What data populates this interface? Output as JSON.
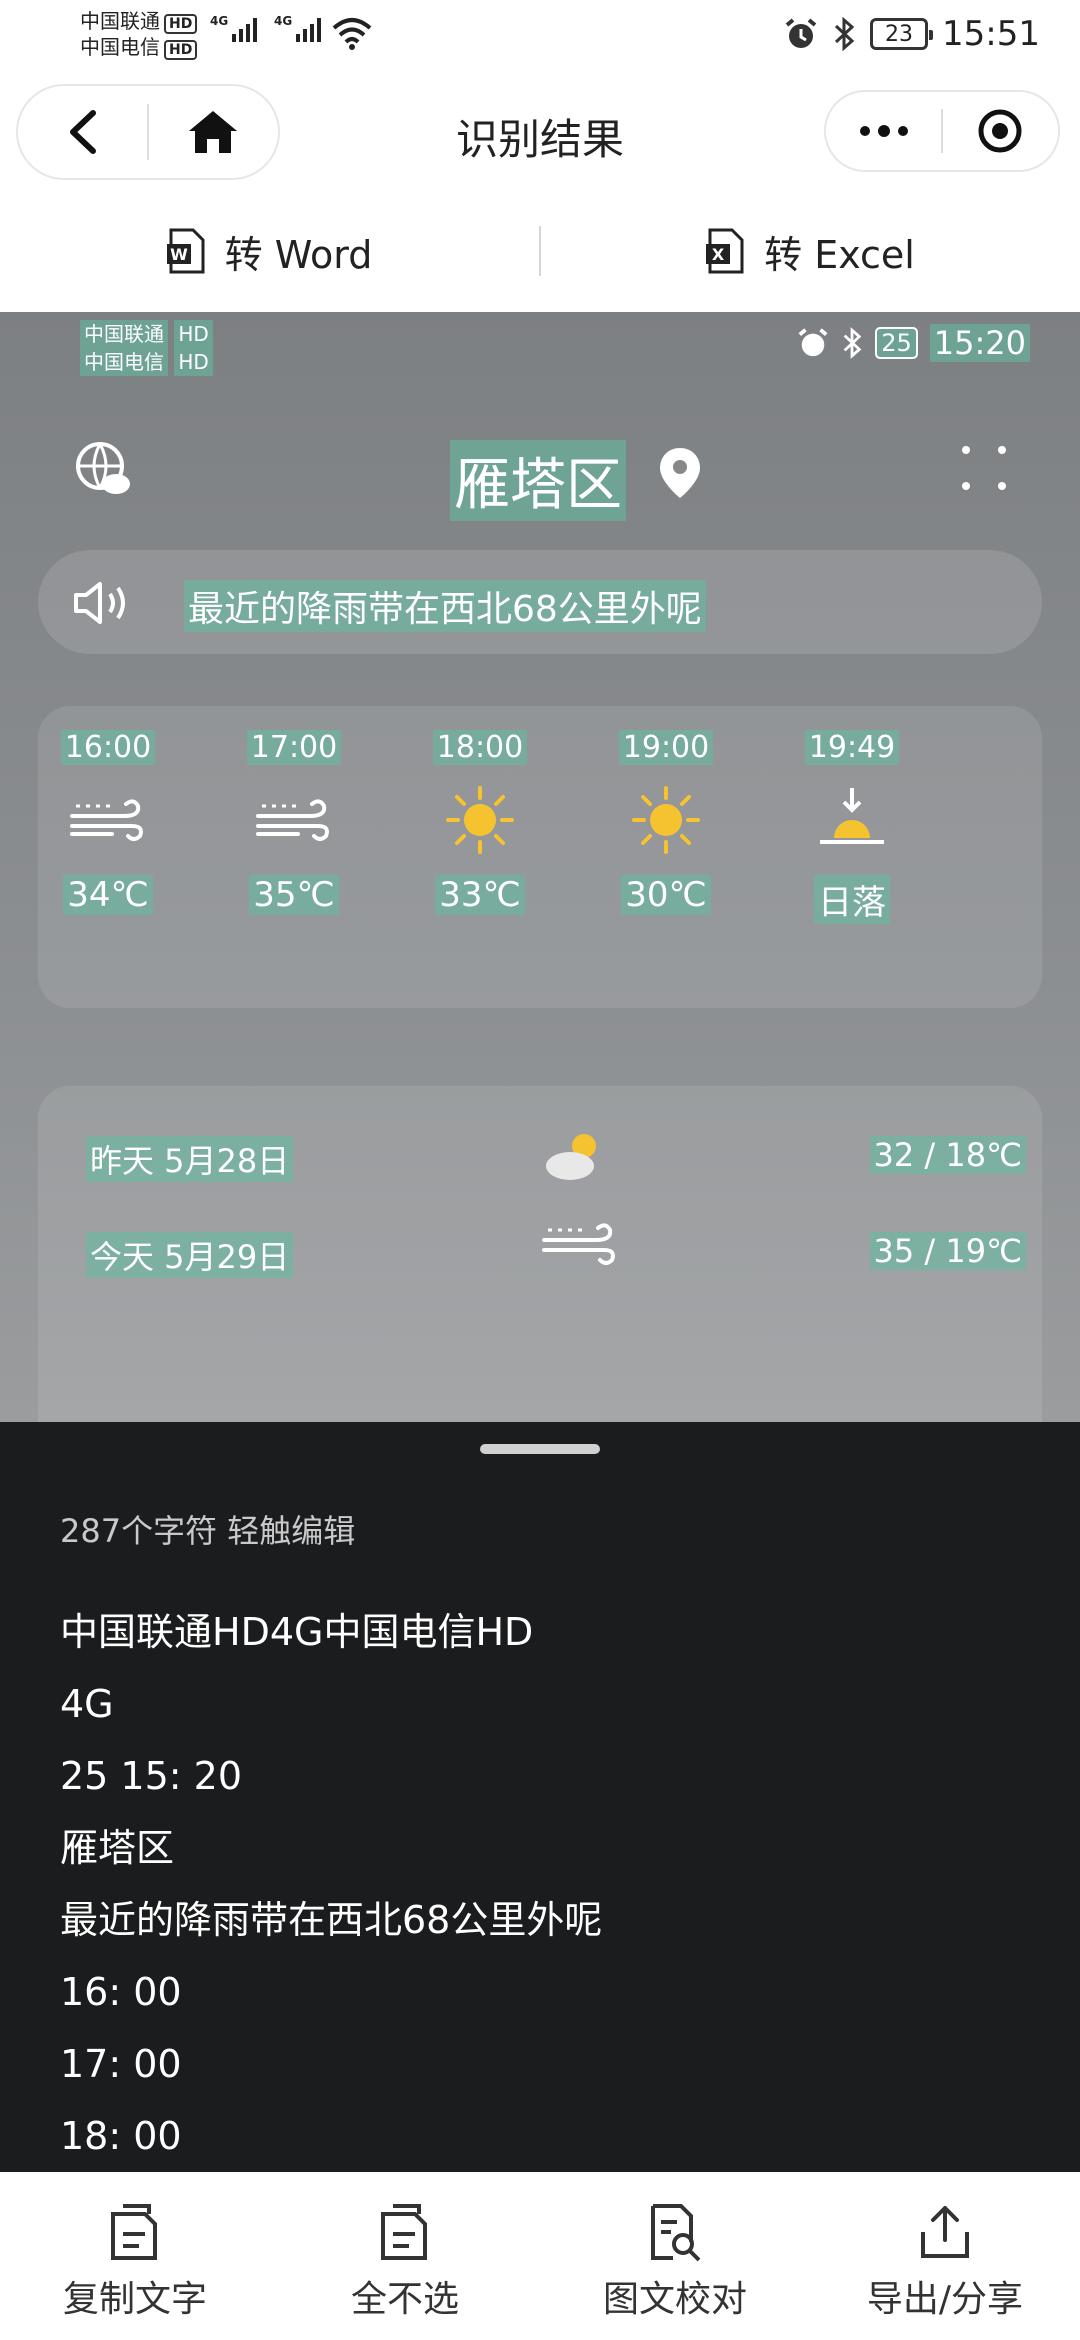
{
  "status_bar": {
    "carrier1": "中国联通",
    "carrier2": "中国电信",
    "hd": "HD",
    "net1": "4G",
    "net2": "4G",
    "battery": "23",
    "time": "15:51"
  },
  "nav": {
    "title": "识别结果"
  },
  "toolbar": {
    "to_word": "转 Word",
    "to_excel": "转 Excel"
  },
  "preview": {
    "carrier1": "中国联通",
    "carrier2": "中国电信",
    "hd": "HD",
    "battery": "25",
    "time": "15:20",
    "city": "雁塔区",
    "alert": "最近的降雨带在西北68公里外呢",
    "hourly": [
      {
        "time": "16:00",
        "icon": "wind-icon",
        "temp": "34℃"
      },
      {
        "time": "17:00",
        "icon": "wind-icon",
        "temp": "35℃"
      },
      {
        "time": "18:00",
        "icon": "sun-icon",
        "temp": "33℃"
      },
      {
        "time": "19:00",
        "icon": "sun-icon",
        "temp": "30℃"
      },
      {
        "time": "19:49",
        "icon": "sunset-icon",
        "temp": "日落"
      }
    ],
    "daily": [
      {
        "label": "昨天 5月28日",
        "icon": "partly-cloudy-icon",
        "range": "32 / 18℃"
      },
      {
        "label": "今天 5月29日",
        "icon": "wind-icon",
        "range": "35 / 19℃"
      }
    ]
  },
  "sheet": {
    "count": "287个字符 轻触编辑",
    "lines": [
      "中国联通HD4G中国电信HD",
      "4G",
      "25 15: 20",
      "雁塔区",
      "最近的降雨带在西北68公里外呢",
      "16: 00",
      "17: 00",
      "18: 00"
    ]
  },
  "actions": {
    "copy": "复制文字",
    "deselect": "全不选",
    "proofread": "图文校对",
    "export": "导出/分享"
  }
}
